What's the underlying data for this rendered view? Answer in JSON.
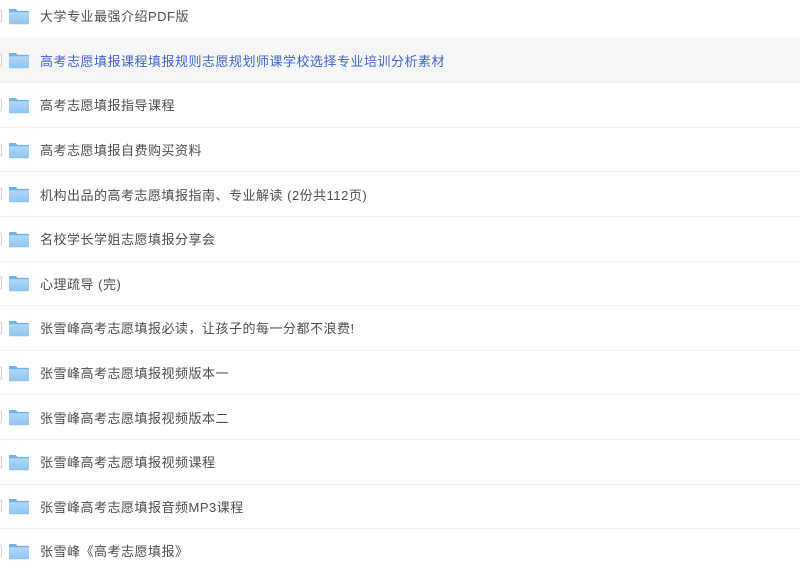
{
  "page": {
    "background": "#ffffff"
  },
  "colors": {
    "normal_text": "#4d4d4d",
    "selected_text": "#4164d2",
    "selected_row_bg": "#f5f6f5",
    "row_divider": "#f1f1f1",
    "folder_back": "#72b1e8",
    "folder_front_top": "#aed7f6",
    "folder_front_bottom": "#8fc4f0",
    "checkbox_border": "#cfcfcf"
  },
  "list": {
    "items": [
      {
        "label": "大学专业最强介绍PDF版",
        "selected": false,
        "icon": "folder-icon"
      },
      {
        "label": "高考志愿填报课程填报规则志愿规划师课学校选择专业培训分析素材",
        "selected": true,
        "icon": "folder-icon"
      },
      {
        "label": "高考志愿填报指导课程",
        "selected": false,
        "icon": "folder-icon"
      },
      {
        "label": "高考志愿填报自费购买资料",
        "selected": false,
        "icon": "folder-icon"
      },
      {
        "label": "机构出品的高考志愿填报指南、专业解读 (2份共112页)",
        "selected": false,
        "icon": "folder-icon"
      },
      {
        "label": "名校学长学姐志愿填报分享会",
        "selected": false,
        "icon": "folder-icon"
      },
      {
        "label": "心理疏导 (完)",
        "selected": false,
        "icon": "folder-icon"
      },
      {
        "label": "张雪峰高考志愿填报必读，让孩子的每一分都不浪费!",
        "selected": false,
        "icon": "folder-icon"
      },
      {
        "label": "张雪峰高考志愿填报视频版本一",
        "selected": false,
        "icon": "folder-icon"
      },
      {
        "label": "张雪峰高考志愿填报视频版本二",
        "selected": false,
        "icon": "folder-icon"
      },
      {
        "label": "张雪峰高考志愿填报视频课程",
        "selected": false,
        "icon": "folder-icon"
      },
      {
        "label": "张雪峰高考志愿填报音频MP3课程",
        "selected": false,
        "icon": "folder-icon"
      },
      {
        "label": "张雪峰《高考志愿填报》",
        "selected": false,
        "icon": "folder-icon"
      }
    ]
  }
}
